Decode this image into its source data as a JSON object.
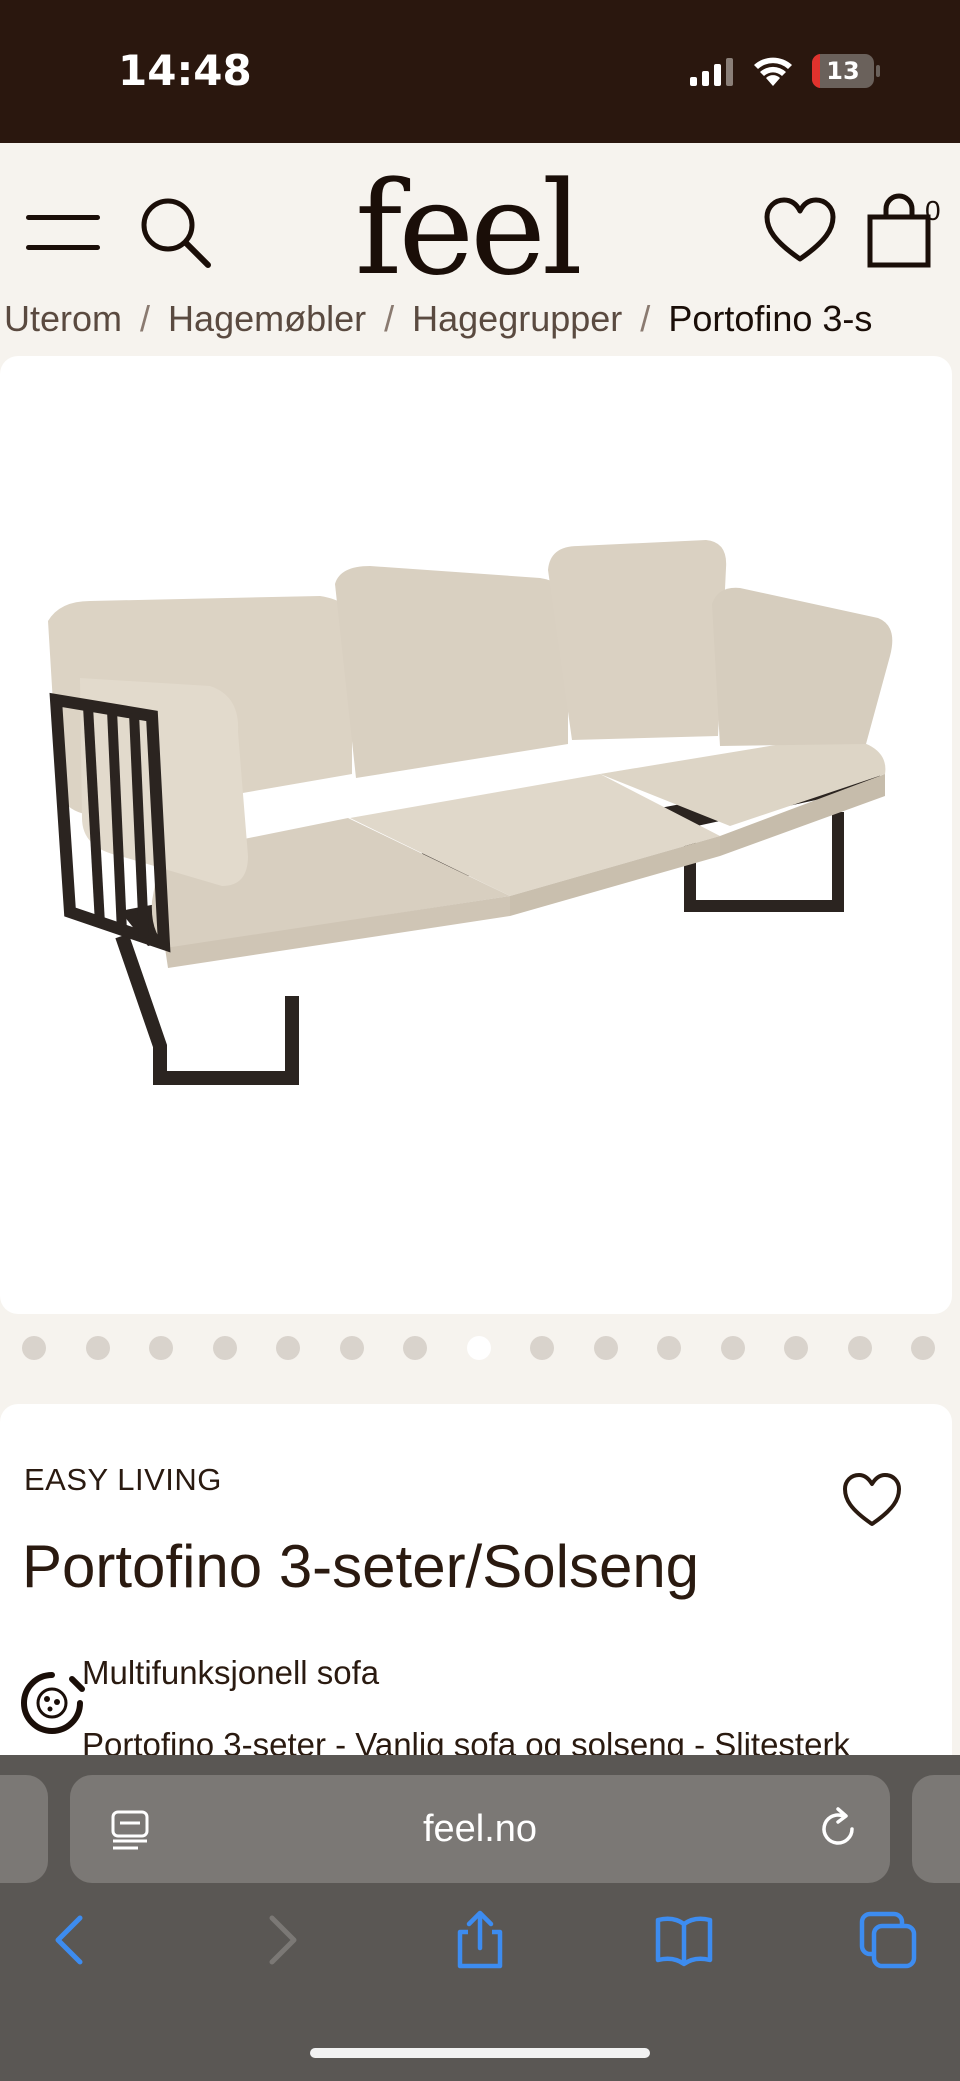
{
  "status_bar": {
    "time": "14:48",
    "battery_level": "13",
    "battery_fraction": 0.13,
    "battery_color": "#e0322d"
  },
  "header": {
    "logo": "feel",
    "cart_count": "0",
    "icons": [
      "menu-icon",
      "search-icon",
      "heart-icon",
      "cart-icon"
    ]
  },
  "breadcrumb": {
    "items": [
      "Uterom",
      "Hagemøbler",
      "Hagegrupper",
      "Portofino 3-s"
    ]
  },
  "gallery": {
    "image_alt": "Portofino 3-seter/Solseng",
    "slide_count": 15,
    "active_slide": 8
  },
  "product": {
    "brand": "EASY LIVING",
    "title": "Portofino 3-seter/Solseng",
    "subtitle": "Multifunksjonell sofa",
    "description": "Portofino 3-seter - Vanlig sofa og solseng - Slitesterk"
  },
  "browser": {
    "url": "feel.no",
    "toolbar": [
      "back-icon",
      "forward-icon",
      "share-icon",
      "bookmarks-icon",
      "tabs-icon"
    ]
  },
  "colors": {
    "header_bg": "#2a170e",
    "page_bg": "#f6f3ee",
    "text": "#2a1a10",
    "browser_bg": "#5a5754",
    "ios_blue": "#3d8cf0"
  }
}
